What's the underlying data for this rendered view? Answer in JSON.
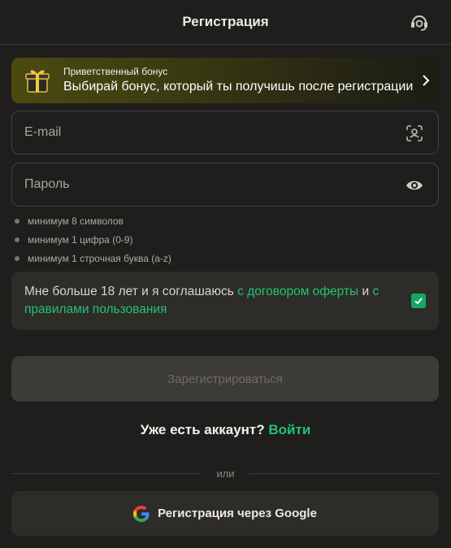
{
  "header": {
    "title": "Регистрация",
    "support_icon": "headset-icon"
  },
  "bonus": {
    "label": "Приветственный бонус",
    "text": "Выбирай бонус, который ты получишь после регистрации",
    "icon": "gift-icon"
  },
  "form": {
    "email_placeholder": "E-mail",
    "password_placeholder": "Пароль",
    "password_rules": [
      "минимум 8 символов",
      "минимум 1 цифра (0-9)",
      "минимум 1 строчная буква (a-z)"
    ]
  },
  "agreement": {
    "text_before": "Мне больше 18 лет и я соглашаюсь ",
    "link1": "с договором оферты",
    "text_middle": " и ",
    "link2": "с правилами пользования",
    "checked": true
  },
  "submit_label": "Зарегистрироваться",
  "login": {
    "prompt": "Уже есть аккаунт?",
    "link": "Войти"
  },
  "divider_text": "или",
  "google_label": "Регистрация через Google",
  "colors": {
    "accent": "#20c374",
    "background": "#1f1e1c",
    "checkbox": "#16a765"
  }
}
